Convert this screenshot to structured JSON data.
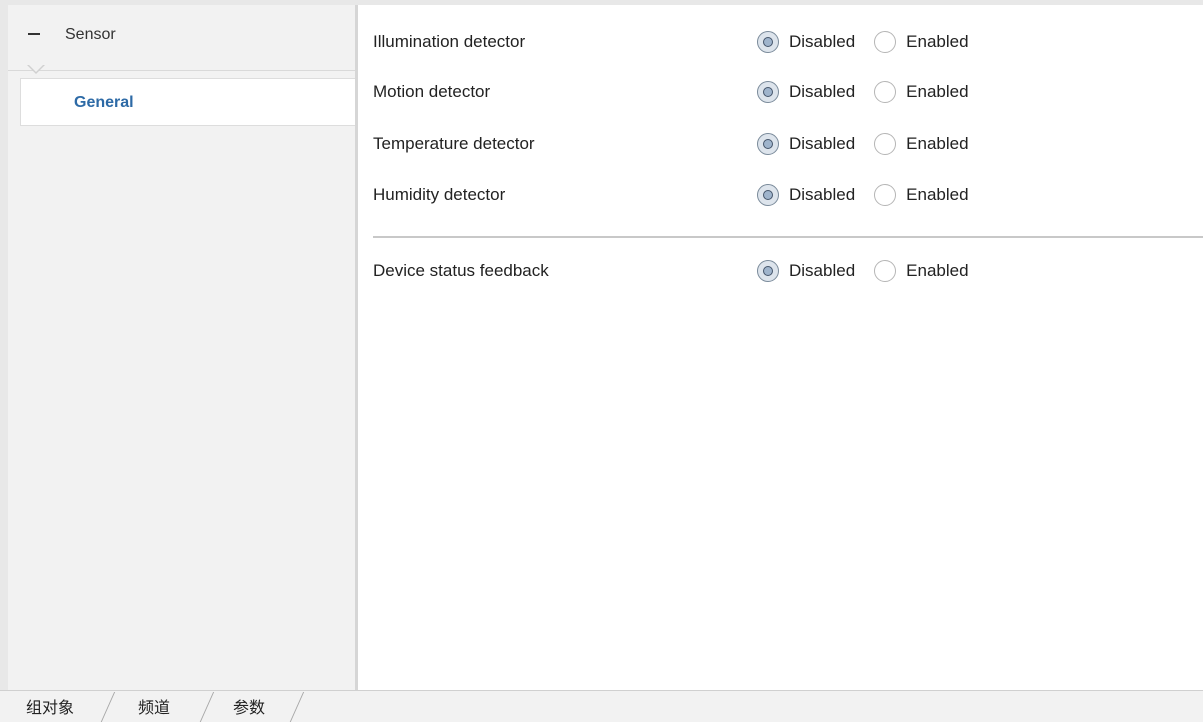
{
  "sidebar": {
    "group_label": "Sensor",
    "items": [
      {
        "label": "General"
      }
    ]
  },
  "parameters": [
    {
      "label": "Illumination detector",
      "options": [
        "Disabled",
        "Enabled"
      ],
      "selected": "Disabled"
    },
    {
      "label": "Motion detector",
      "options": [
        "Disabled",
        "Enabled"
      ],
      "selected": "Disabled"
    },
    {
      "label": "Temperature detector",
      "options": [
        "Disabled",
        "Enabled"
      ],
      "selected": "Disabled"
    },
    {
      "label": "Humidity detector",
      "options": [
        "Disabled",
        "Enabled"
      ],
      "selected": "Disabled"
    },
    {
      "label": "Device status feedback",
      "options": [
        "Disabled",
        "Enabled"
      ],
      "selected": "Disabled"
    }
  ],
  "tabs": [
    {
      "label": "组对象"
    },
    {
      "label": "频道"
    },
    {
      "label": "参数"
    }
  ],
  "active_tab": "参数",
  "colors": {
    "accent_text": "#2d6aa6",
    "panel_background": "#f2f2f2"
  },
  "icons": {
    "collapse": "minus-icon",
    "radio_selected": "radio-checked-icon",
    "radio_unselected": "radio-unchecked-icon"
  }
}
